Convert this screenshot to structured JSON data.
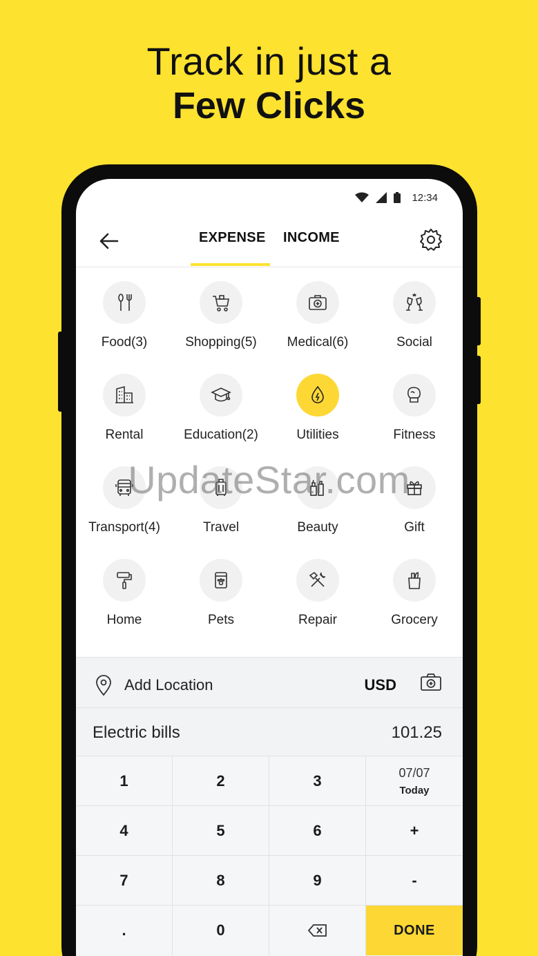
{
  "headline": {
    "line1": "Track in just a",
    "line2": "Few Clicks"
  },
  "status_bar": {
    "time": "12:34"
  },
  "tabs": {
    "expense": "EXPENSE",
    "income": "INCOME"
  },
  "categories": [
    {
      "label": "Food(3)",
      "icon": "fork-knife-icon"
    },
    {
      "label": "Shopping(5)",
      "icon": "shopping-cart-icon"
    },
    {
      "label": "Medical(6)",
      "icon": "medical-kit-icon"
    },
    {
      "label": "Social",
      "icon": "cheers-icon"
    },
    {
      "label": "Rental",
      "icon": "building-icon"
    },
    {
      "label": "Education(2)",
      "icon": "graduation-cap-icon"
    },
    {
      "label": "Utilities",
      "icon": "utilities-drop-icon"
    },
    {
      "label": "Fitness",
      "icon": "boxing-glove-icon"
    },
    {
      "label": "Transport(4)",
      "icon": "bus-icon"
    },
    {
      "label": "Travel",
      "icon": "suitcase-icon"
    },
    {
      "label": "Beauty",
      "icon": "cosmetics-icon"
    },
    {
      "label": "Gift",
      "icon": "gift-icon"
    },
    {
      "label": "Home",
      "icon": "paint-roller-icon"
    },
    {
      "label": "Pets",
      "icon": "pet-food-icon"
    },
    {
      "label": "Repair",
      "icon": "tools-icon"
    },
    {
      "label": "Grocery",
      "icon": "grocery-bag-icon"
    }
  ],
  "selected_category": "Utilities",
  "colors": {
    "accent": "#FDD835",
    "background": "#FDE22F"
  },
  "location": {
    "label": "Add Location",
    "currency": "USD"
  },
  "entry": {
    "note": "Electric bills",
    "amount": "101.25"
  },
  "keypad": {
    "k1": "1",
    "k2": "2",
    "k3": "3",
    "date": "07/07",
    "date_label": "Today",
    "k4": "4",
    "k5": "5",
    "k6": "6",
    "plus": "+",
    "k7": "7",
    "k8": "8",
    "k9": "9",
    "minus": "-",
    "dot": ".",
    "k0": "0",
    "done": "DONE"
  },
  "watermark": "UpdateStar.com"
}
